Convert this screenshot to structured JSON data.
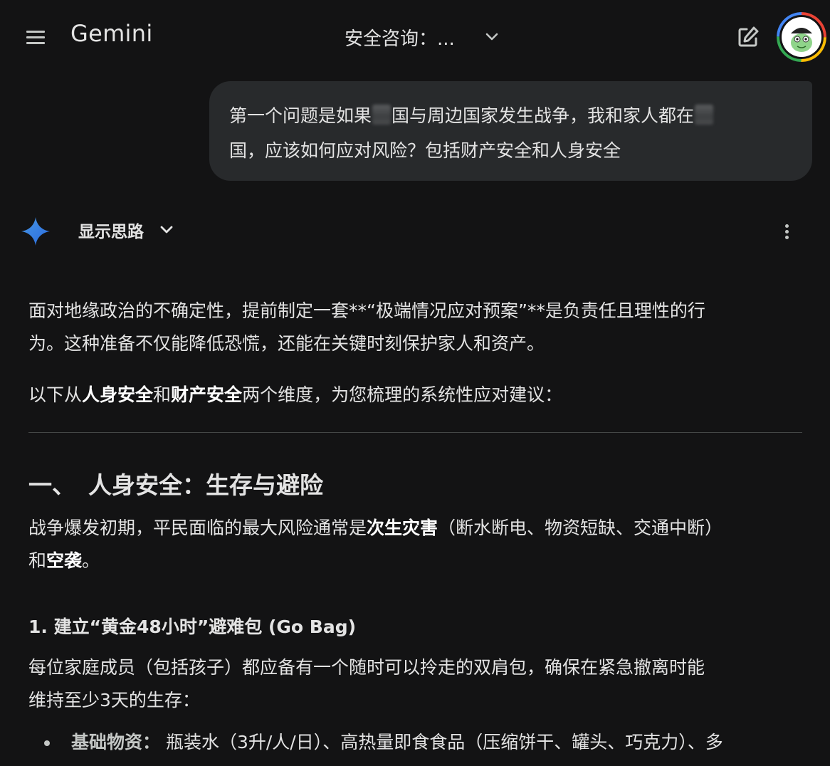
{
  "header": {
    "brand": "Gemini",
    "chat_title": "安全咨询：...",
    "icons": {
      "menu": "menu-icon",
      "dropdown": "chevron-down-icon",
      "new_chat": "edit-icon",
      "avatar": "avatar"
    }
  },
  "user_message": {
    "line1_part1": "第一个问题是如果",
    "line1_part2": "国与周边国家发生战争，我和家人都在",
    "line2": "国，应该如何应对风险？包括财产安全和人身安全"
  },
  "model_response": {
    "thoughts_toggle": "显示思路",
    "intro": {
      "line1": "面对地缘政治的不确定性，提前制定一套**“极端情况应对预案”**是负责任且理性的行",
      "line2": "为。这种准备不仅能降低恐慌，还能在关键时刻保护家人和资产。"
    },
    "overview": {
      "pre": "以下从",
      "bold1": "人身安全",
      "mid": "和",
      "bold2": "财产安全",
      "post": "两个维度，为您梳理的系统性应对建议："
    },
    "section1": {
      "number": "一、",
      "title": "人身安全：生存与避险",
      "para_line1_pre": "战争爆发初期，平民面临的最大风险通常是",
      "para_line1_bold": "次生灾害",
      "para_line1_post": "（断水断电、物资短缺、交通中断）",
      "para_line2_pre": "和",
      "para_line2_bold": "空袭",
      "para_line2_post": "。"
    },
    "subsection1": {
      "title": "1. 建立“黄金48小时”避难包 (Go Bag)",
      "para_line1": "每位家庭成员（包括孩子）都应备有一个随时可以拎走的双肩包，确保在紧急撤离时能",
      "para_line2": "维持至少3天的生存："
    },
    "bullets": [
      {
        "key": "基础物资：",
        "text": "瓶装水（3升/人/日）、高热量即食食品（压缩饼干、罐头、巧克力）、多"
      }
    ]
  },
  "colors": {
    "background": "#131314",
    "bubble": "#282a2c",
    "text": "#e3e3e3",
    "accent_blue": "#4285f4"
  }
}
